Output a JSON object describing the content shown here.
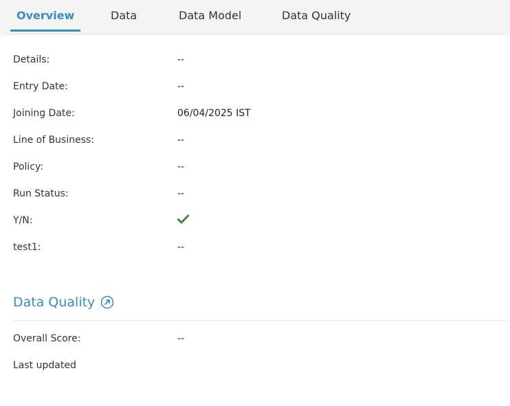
{
  "tabs": [
    {
      "label": "Overview",
      "active": true
    },
    {
      "label": "Data",
      "active": false
    },
    {
      "label": "Data Model",
      "active": false
    },
    {
      "label": "Data Quality",
      "active": false
    }
  ],
  "details": [
    {
      "label": "Details:",
      "value": "--"
    },
    {
      "label": "Entry Date:",
      "value": "--"
    },
    {
      "label": "Joining Date:",
      "value": "06/04/2025 IST"
    },
    {
      "label": "Line of Business:",
      "value": "--"
    },
    {
      "label": "Policy:",
      "value": "--"
    },
    {
      "label": "Run Status:",
      "value": "--"
    },
    {
      "label": "Y/N:",
      "value_icon": "check-icon"
    },
    {
      "label": "test1:",
      "value": "--"
    }
  ],
  "data_quality": {
    "title": "Data Quality",
    "link_icon": "external-link-icon",
    "overall_score_label": "Overall Score:",
    "overall_score_value": "--",
    "last_updated_label": "Last updated"
  },
  "colors": {
    "accent": "#3a8cbf",
    "check": "#3c8a3c",
    "tabbar_bg": "#f4f4f4"
  }
}
